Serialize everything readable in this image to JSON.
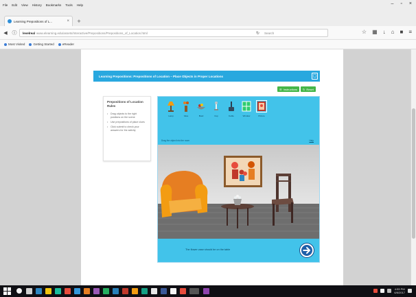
{
  "browser": {
    "menu": [
      "File",
      "Edit",
      "View",
      "History",
      "Bookmarks",
      "Tools",
      "Help"
    ],
    "window_controls": [
      "–",
      "▫",
      "×"
    ],
    "tab": {
      "title": "Learning Prepositions of L...",
      "close": "×"
    },
    "new_tab": "+",
    "address": {
      "host": "levelreal",
      "path": "www.elearning.edu/assets/Interactive/Prepositions/Prepositions_of_Location.html",
      "search_placeholder": "Search"
    },
    "bookmarks": [
      "Most Visited",
      "Getting Started",
      "eReader"
    ]
  },
  "lesson": {
    "title": "Learning Prepositions: Prepositions of Location – Place Objects in Proper Locations",
    "buttons": [
      {
        "label": "Instructions",
        "color": "#45b649"
      },
      {
        "label": "Reset",
        "color": "#45b649"
      }
    ],
    "instructions": {
      "title": "Prepositions of Location Rules",
      "items": [
        "Drag objects to the right positions on the scene",
        "Use prepositions of place clues",
        "Click submit to check your answers for the activity"
      ]
    }
  },
  "activity": {
    "tray_items": [
      {
        "label": "Lamp",
        "icon": "lamp-icon"
      },
      {
        "label": "Vase",
        "icon": "vase-icon"
      },
      {
        "label": "Bowl",
        "icon": "bowl-icon"
      },
      {
        "label": "Cup",
        "icon": "cup-icon"
      },
      {
        "label": "Kettle",
        "icon": "kettle-icon"
      },
      {
        "label": "Window",
        "icon": "window-icon"
      },
      {
        "label": "Picture",
        "icon": "picture-icon"
      }
    ],
    "tray_instruction": "Drag the object into the room",
    "tray_link": "Help",
    "footer_text": "The flower vase should be on the table",
    "colors": {
      "tray": "#42c3ea",
      "next": "#1f5fa8"
    }
  },
  "taskbar": {
    "clock_time": "4:53 PM",
    "clock_date": "6/6/2017"
  }
}
